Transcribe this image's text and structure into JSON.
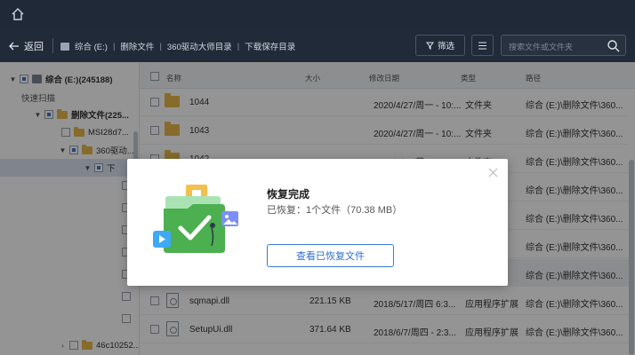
{
  "titlebar": {
    "home_icon": "home-icon"
  },
  "nav": {
    "back_label": "返回",
    "breadcrumbs": [
      "综合 (E:)",
      "删除文件",
      "360驱动大师目录",
      "下载保存目录"
    ],
    "filter_label": "筛选",
    "search_placeholder": "搜索文件或文件夹"
  },
  "sidebar": {
    "root_label": "综合 (E:)(245188)",
    "quick_scan": "快速扫描",
    "deleted_label": "删除文件(225...",
    "msi_label": "MSI28d7...",
    "d360_label": "360驱动...",
    "sel_label": "下",
    "bottom_label": "46c10252..."
  },
  "table": {
    "headers": {
      "name": "名称",
      "size": "大小",
      "modified": "修改日期",
      "type": "类型",
      "path": "路径"
    },
    "rows": [
      {
        "name": "1044",
        "size": "",
        "date": "2020/4/27/周一 - 10:...",
        "type": "文件夹",
        "path": "综合 (E:)\\删除文件\\360..."
      },
      {
        "name": "1043",
        "size": "",
        "date": "2020/4/27/周一 - 10:...",
        "type": "文件夹",
        "path": "综合 (E:)\\删除文件\\360..."
      },
      {
        "name": "1042",
        "size": "",
        "date": "2020/4/27/周一 - 10:...",
        "type": "文件夹",
        "path": "综合 (E:)\\删除文件\\360..."
      },
      {
        "name": "",
        "size": "",
        "date": "",
        "type": "",
        "path": "综合 (E:)\\删除文件\\360..."
      },
      {
        "name": "",
        "size": "",
        "date": "",
        "type": "",
        "path": "综合 (E:)\\删除文件\\360..."
      },
      {
        "name": "",
        "size": "",
        "date": "",
        "type": "",
        "path": "综合 (E:)\\删除文件\\360..."
      },
      {
        "name": "",
        "size": "",
        "date": "",
        "type": "",
        "path": "综合 (E:)\\删除文件\\360..."
      },
      {
        "name": "sqmapi.dll",
        "size": "221.15 KB",
        "date": "2018/5/17/周四 6:3...",
        "type": "应用程序扩展",
        "path": "综合 (E:)\\删除文件\\360..."
      },
      {
        "name": "SetupUi.dll",
        "size": "371.64 KB",
        "date": "2018/6/7/周四 - 2:3...",
        "type": "应用程序扩展",
        "path": "综合 (E:)\\删除文件\\360..."
      }
    ]
  },
  "dialog": {
    "title": "恢复完成",
    "status": "已恢复：1个文件（70.38 MB）",
    "button_label": "查看已恢复文件"
  },
  "colors": {
    "accent": "#3a7bd5",
    "titlebar": "#1f2937",
    "folder": "#e8b84d",
    "success_green": "#4caf50"
  }
}
